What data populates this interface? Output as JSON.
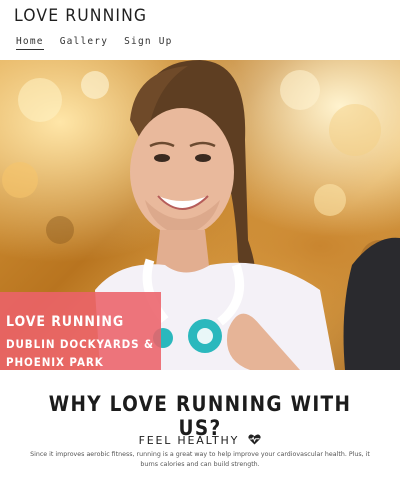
{
  "header": {
    "brand": "LOVE RUNNING",
    "nav": [
      {
        "label": "Home",
        "active": true
      },
      {
        "label": "Gallery",
        "active": false
      },
      {
        "label": "Sign Up",
        "active": false
      }
    ]
  },
  "hero": {
    "overlay_title": "LOVE RUNNING",
    "overlay_subtitle": "DUBLIN DOCKYARDS & PHOENIX PARK",
    "overlay_color": "#ec626a"
  },
  "section": {
    "title": "WHY LOVE RUNNING WITH US?",
    "feature_title": "FEEL HEALTHY",
    "feature_icon": "heart-pulse-icon",
    "feature_text": "Since it improves aerobic fitness, running is a great way to help improve your cardiovascular health. Plus, it burns calories and can build strength."
  }
}
